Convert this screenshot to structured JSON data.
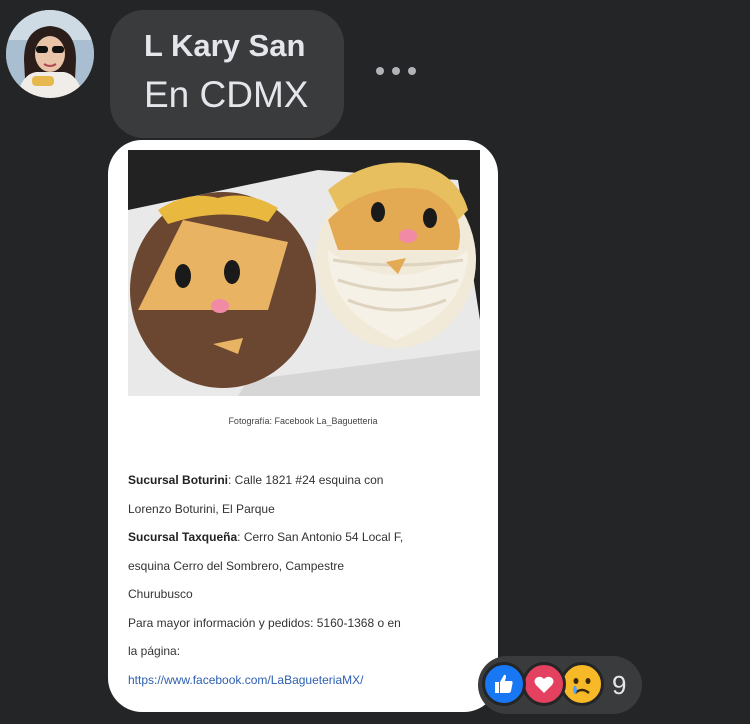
{
  "comment": {
    "author": "L Kary San",
    "text": "En CDMX"
  },
  "attachment": {
    "caption": "Fotografía: Facebook La_Baguetteria",
    "branch1_name": "Sucursal Boturini",
    "branch1_address_a": ": Calle 1821 #24 esquina con",
    "branch1_address_b": "Lorenzo Boturini, El Parque",
    "branch2_name": "Sucursal Taxqueña",
    "branch2_address_a": ": Cerro San Antonio 54 Local F,",
    "branch2_address_b": "esquina Cerro del Sombrero, Campestre",
    "branch2_address_c": "Churubusco",
    "contact_a": "Para mayor información y pedidos: 5160-1368 o en",
    "contact_b": "la página:",
    "link": "https://www.facebook.com/LaBagueteriaMX/"
  },
  "reactions": {
    "icons": [
      "like-icon",
      "love-icon",
      "sad-icon"
    ],
    "count": "9",
    "colors": {
      "like": "#1877f2",
      "love": "#e4405f",
      "sad": "#f7b928"
    }
  },
  "colors": {
    "background": "#242526",
    "bubble": "#3a3b3c",
    "text": "#e4e6eb"
  }
}
